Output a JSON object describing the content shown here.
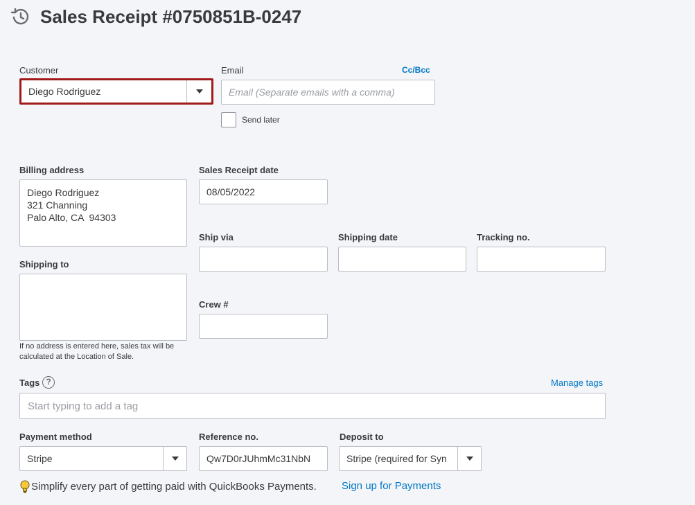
{
  "header": {
    "title": "Sales Receipt #0750851B-0247",
    "history_icon": "clock-history-icon"
  },
  "customer": {
    "label": "Customer",
    "value": "Diego Rodriguez"
  },
  "email": {
    "label": "Email",
    "placeholder": "Email (Separate emails with a comma)",
    "cc_bcc": "Cc/Bcc",
    "send_later": "Send later"
  },
  "billing": {
    "label": "Billing address",
    "lines": [
      "Diego Rodriguez",
      "321 Channing",
      "Palo Alto, CA  94303"
    ]
  },
  "shipping_to": {
    "label": "Shipping to",
    "note": "If no address is entered here, sales tax will be calculated at the Location of Sale."
  },
  "receipt_date": {
    "label": "Sales Receipt date",
    "value": "08/05/2022"
  },
  "ship_via": {
    "label": "Ship via"
  },
  "shipping_date": {
    "label": "Shipping date"
  },
  "tracking": {
    "label": "Tracking no."
  },
  "crew": {
    "label": "Crew #"
  },
  "tags": {
    "label": "Tags",
    "placeholder": "Start typing to add a tag",
    "manage": "Manage tags"
  },
  "payment_method": {
    "label": "Payment method",
    "value": "Stripe"
  },
  "reference": {
    "label": "Reference no.",
    "value": "Qw7D0rJUhmMc31NbN"
  },
  "deposit_to": {
    "label": "Deposit to",
    "value": "Stripe (required for Syn"
  },
  "promo": {
    "text": "Simplify every part of getting paid with QuickBooks Payments.",
    "link": "Sign up for Payments"
  },
  "colors": {
    "accent_link": "#0077c5",
    "focus_border": "#a01a1a",
    "background": "#f4f5f8"
  }
}
